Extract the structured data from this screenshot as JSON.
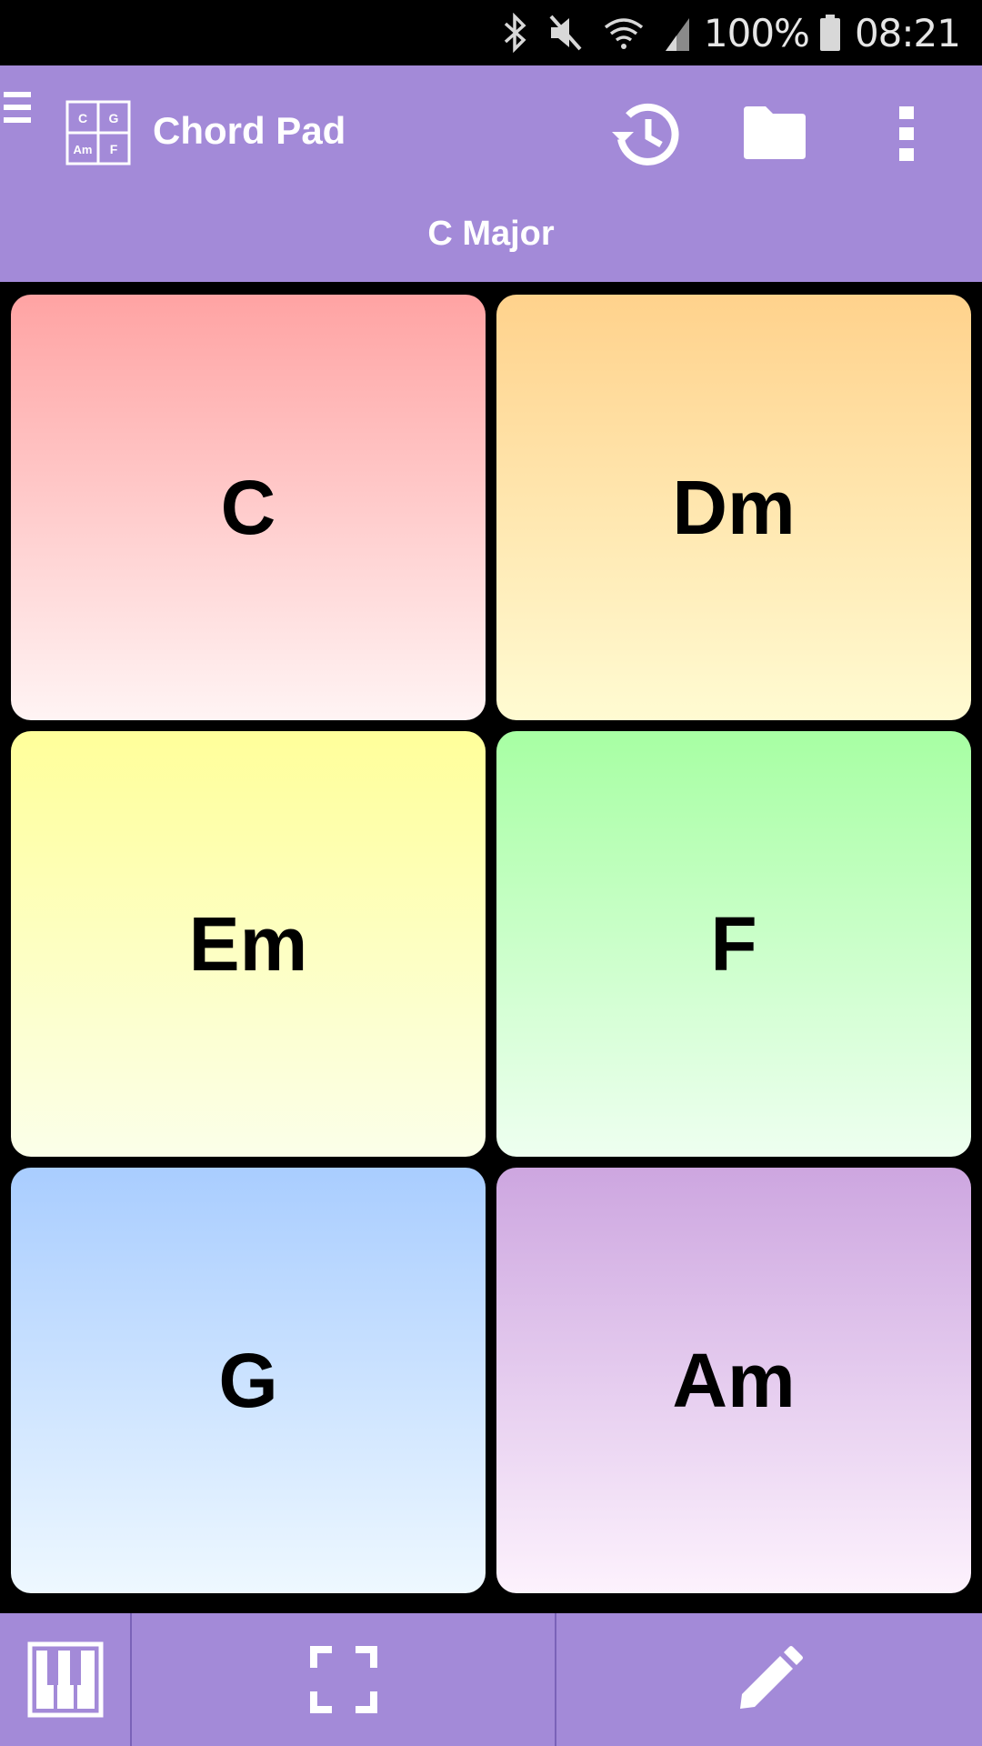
{
  "status_bar": {
    "icons": [
      "bluetooth-icon",
      "mute-icon",
      "wifi-icon",
      "signal-icon"
    ],
    "battery_text": "100%",
    "battery_icon": "battery-icon",
    "time": "08:21"
  },
  "toolbar": {
    "menu_icon": "hamburger-menu-icon",
    "logo": {
      "cells": [
        "C",
        "G",
        "Am",
        "F"
      ]
    },
    "title": "Chord Pad",
    "subtitle": "C Major",
    "actions": [
      "history-icon",
      "folder-icon",
      "more-vert-icon"
    ],
    "background": "#a38ad8"
  },
  "pads": [
    {
      "label": "C",
      "color_top": "#ffa3a3",
      "color_bottom": "#fff4f4"
    },
    {
      "label": "Dm",
      "color_top": "#ffd28c",
      "color_bottom": "#fffbd2"
    },
    {
      "label": "Em",
      "color_top": "#ffff9a",
      "color_bottom": "#fbffe9"
    },
    {
      "label": "F",
      "color_top": "#a7ffa3",
      "color_bottom": "#eefff0"
    },
    {
      "label": "G",
      "color_top": "#a9cdff",
      "color_bottom": "#eef8ff"
    },
    {
      "label": "Am",
      "color_top": "#cda6e0",
      "color_bottom": "#fdf2fd"
    }
  ],
  "bottom_bar": {
    "buttons": [
      "piano-keys-icon",
      "fullscreen-icon",
      "edit-pencil-icon"
    ]
  }
}
